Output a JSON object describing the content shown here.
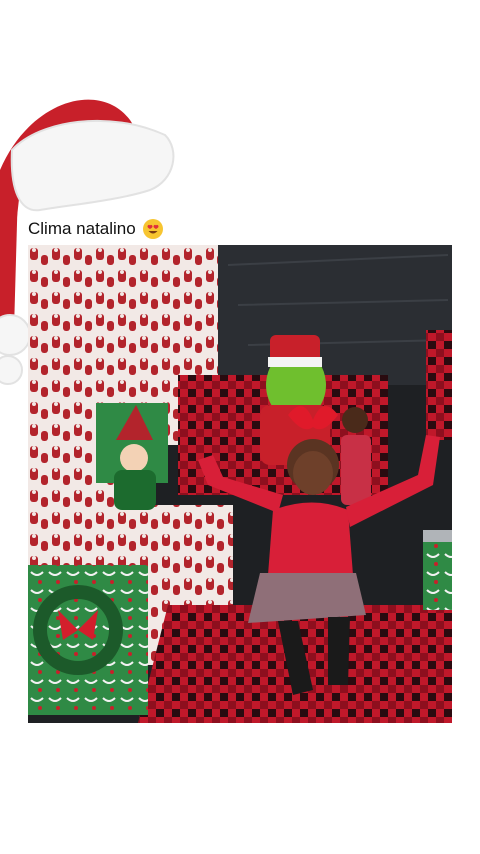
{
  "post": {
    "caption": "Clima natalino",
    "emoji": "smiling-face-with-heart-eyes"
  },
  "decoration": {
    "icon": "santa-hat-icon",
    "hat_red": "#c8202a",
    "fur_white": "#f4f4f4"
  },
  "photo": {
    "alt": "",
    "theme": {
      "wrapping_red": "#b3242c",
      "wrapping_white": "#f2e9e6",
      "floor_red": "#c0182a",
      "wall_black": "#1e2023",
      "sweater_red": "#d81f38",
      "grinch_green": "#6fbf2e"
    }
  }
}
